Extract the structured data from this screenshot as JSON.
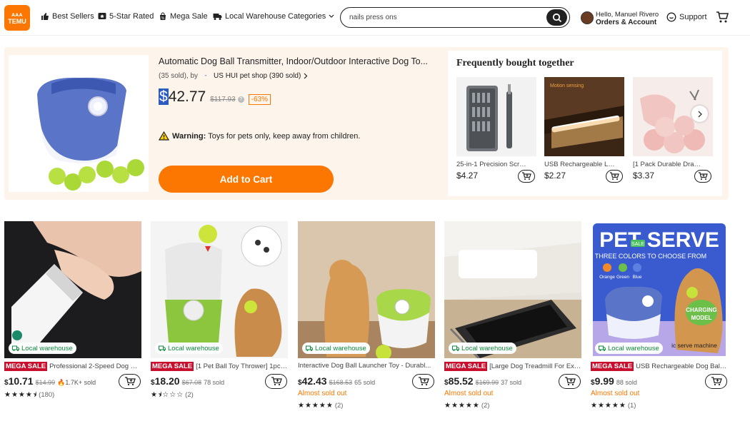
{
  "header": {
    "logo_line1": "ᴀᴀᴀ",
    "logo_line2": "TEMU",
    "nav": [
      "Best Sellers",
      "5-Star Rated",
      "Mega Sale",
      "Local Warehouse",
      "Categories"
    ],
    "search_value": "nails press ons",
    "account_greeting": "Hello, Manuel Rivero",
    "account_label": "Orders & Account",
    "support": "Support"
  },
  "feature": {
    "title": "Automatic Dog Ball Transmitter, Indoor/Outdoor Interactive Dog To...",
    "sold": "(35 sold), by",
    "shop": "US HUI pet shop (390 sold)",
    "price_currency": "$",
    "price_amount": "42.77",
    "old_price": "$117.93",
    "discount": "-63%",
    "warning_label": "Warning:",
    "warning_text": "Toys for pets only, keep away from children.",
    "add_to_cart": "Add to Cart"
  },
  "fbt": {
    "title": "Frequently bought together",
    "items": [
      {
        "name": "25-in-1 Precision Screw...",
        "price": "$4.27"
      },
      {
        "name": "USB Rechargeable LED ...",
        "price": "$2.27"
      },
      {
        "name": "[1 Pack Durable Drawstr...",
        "price": "$3.37"
      }
    ]
  },
  "products": [
    {
      "badge": "Local warehouse",
      "mega": "MEGA SALE",
      "title": "Professional 2-Speed Dog Nai...",
      "cur": "$",
      "price": "10.71",
      "old": "$14.99",
      "sold": "🔥1.7K+ sold",
      "almost": "",
      "stars": "★★★★⯨",
      "rating": 4.5,
      "count": "(180)"
    },
    {
      "badge": "Local warehouse",
      "mega": "MEGA SALE",
      "title": "[1 Pet Ball Toy Thrower] 1pc P...",
      "cur": "$",
      "price": "18.20",
      "old": "$67.08",
      "sold": "78 sold",
      "almost": "",
      "stars": "★⯨☆☆☆",
      "rating": 1.5,
      "count": "(2)"
    },
    {
      "badge": "Local warehouse",
      "mega": "",
      "title": "Interactive Dog Ball Launcher Toy - Durabl...",
      "cur": "$",
      "price": "42.43",
      "old": "$168.53",
      "sold": "65 sold",
      "almost": "Almost sold out",
      "stars": "★★★★★",
      "rating": 5,
      "count": "(2)"
    },
    {
      "badge": "Local warehouse",
      "mega": "MEGA SALE",
      "title": "[Large Dog Treadmill For Exer...",
      "cur": "$",
      "price": "85.52",
      "old": "$169.99",
      "sold": "37 sold",
      "almost": "Almost sold out",
      "stars": "★★★★★",
      "rating": 5,
      "count": "(2)"
    },
    {
      "badge": "Local warehouse",
      "mega": "MEGA SALE",
      "title": "USB Rechargeable Dog Ball La...",
      "cur": "$",
      "price": "9.99",
      "old": "",
      "sold": "88 sold",
      "almost": "Almost sold out",
      "stars": "★★★★★",
      "rating": 5,
      "count": "(1)"
    }
  ],
  "promo": {
    "headline": "PET SERVE",
    "sale": "SALE",
    "sub": "THREE COLORS TO CHOOSE FROM",
    "colors": [
      "Orange",
      "Green",
      "Blue"
    ],
    "charging": "CHARGING",
    "model": "MODEL",
    "machine": "ic serve machine"
  },
  "colors": {
    "brand": "#fb7701",
    "mega": "#c8102e",
    "warehouse": "#0a8a3a"
  }
}
